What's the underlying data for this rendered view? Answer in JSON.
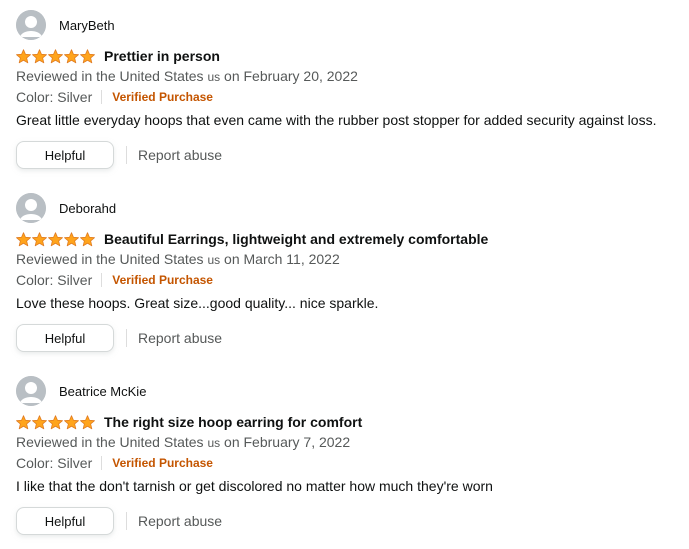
{
  "theme": {
    "star_color": "#ffa41c",
    "verified_color": "#c45500",
    "muted_text_color": "#565959"
  },
  "reviews": [
    {
      "profile_name": "MaryBeth",
      "rating": 5,
      "rating_max": 5,
      "title": "Prettier in person",
      "date_prefix": "Reviewed in the United States",
      "country_flag": "us",
      "date_suffix": "on February 20, 2022",
      "variant": "Color: Silver",
      "verified": "Verified Purchase",
      "body": "Great little everyday hoops that even came with the rubber post stopper for added security against loss.",
      "helpful_label": "Helpful",
      "report_label": "Report abuse"
    },
    {
      "profile_name": "Deborahd",
      "rating": 5,
      "rating_max": 5,
      "title": "Beautiful Earrings, lightweight and extremely comfortable",
      "date_prefix": "Reviewed in the United States",
      "country_flag": "us",
      "date_suffix": "on March 11, 2022",
      "variant": "Color: Silver",
      "verified": "Verified Purchase",
      "body": "Love these hoops. Great size...good quality... nice sparkle.",
      "helpful_label": "Helpful",
      "report_label": "Report abuse"
    },
    {
      "profile_name": "Beatrice McKie",
      "rating": 5,
      "rating_max": 5,
      "title": "The right size hoop earring for comfort",
      "date_prefix": "Reviewed in the United States",
      "country_flag": "us",
      "date_suffix": "on February 7, 2022",
      "variant": "Color: Silver",
      "verified": "Verified Purchase",
      "body": "I like that the don't tarnish or get discolored no matter how much they're worn",
      "helpful_label": "Helpful",
      "report_label": "Report abuse"
    }
  ]
}
